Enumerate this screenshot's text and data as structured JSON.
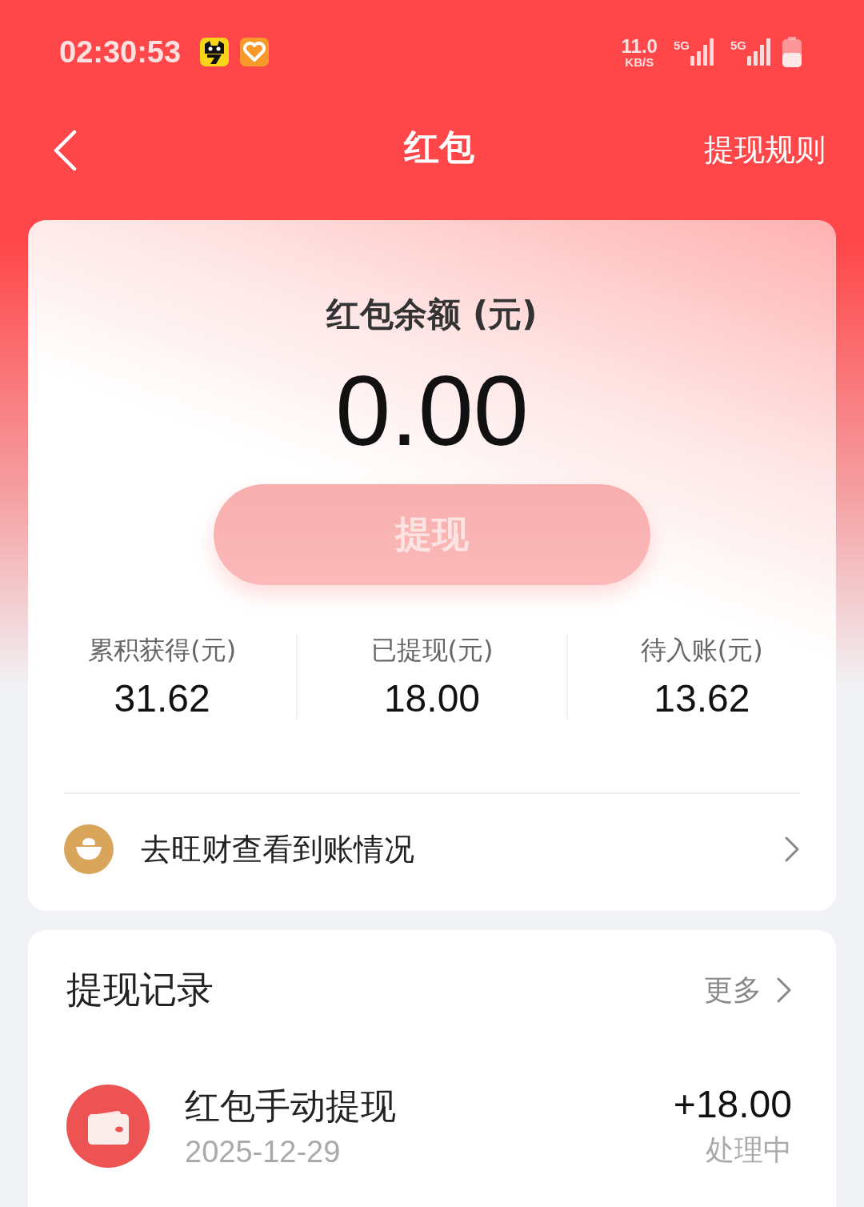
{
  "status_bar": {
    "time": "02:30:53",
    "speed": "11.0",
    "speed_unit": "KB/S",
    "networks": [
      "5G",
      "5G"
    ]
  },
  "header": {
    "title": "红包",
    "action": "提现规则"
  },
  "balance": {
    "label": "红包余额 (元)",
    "amount": "0.00",
    "withdraw_button": {
      "label": "提现",
      "disabled": true
    }
  },
  "stats": [
    {
      "label": "累积获得(元)",
      "value": "31.62"
    },
    {
      "label": "已提现(元)",
      "value": "18.00"
    },
    {
      "label": "待入账(元)",
      "value": "13.62"
    }
  ],
  "link": {
    "label": "去旺财查看到账情况"
  },
  "records": {
    "title": "提现记录",
    "more": "更多",
    "items": [
      {
        "title": "红包手动提现",
        "date": "2025-12-29",
        "amount": "+18.00",
        "status": "处理中"
      }
    ]
  }
}
